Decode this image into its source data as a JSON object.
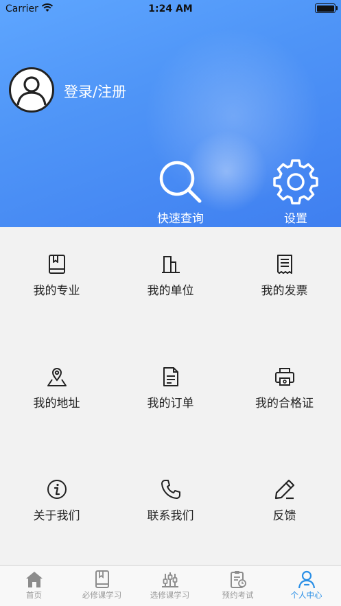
{
  "status_bar": {
    "carrier": "Carrier",
    "time": "1:24 AM"
  },
  "header": {
    "login_label": "登录/注册",
    "quick_query_label": "快速查询",
    "settings_label": "设置"
  },
  "menu": {
    "my_major": "我的专业",
    "my_unit": "我的单位",
    "my_invoice": "我的发票",
    "my_address": "我的地址",
    "my_orders": "我的订单",
    "my_certificate": "我的合格证",
    "about_us": "关于我们",
    "contact_us": "联系我们",
    "feedback": "反馈"
  },
  "tabbar": {
    "home": "首页",
    "required": "必修课学习",
    "elective": "选修课学习",
    "exam": "预约考试",
    "profile": "个人中心"
  },
  "colors": {
    "header_blue": "#4f95f7",
    "active_tab": "#2a8fe6",
    "inactive_tab": "#9a9a9a"
  },
  "active_tab": "profile"
}
